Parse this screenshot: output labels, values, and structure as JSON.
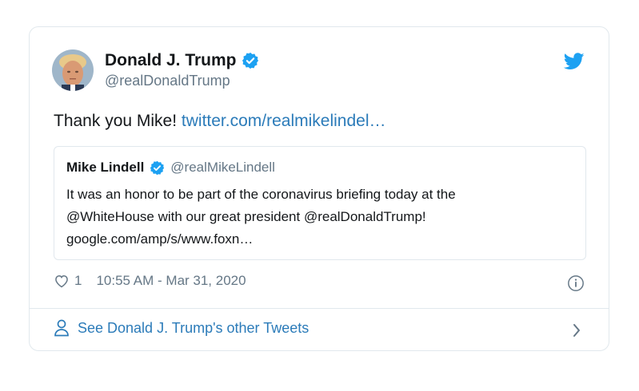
{
  "tweet": {
    "author": {
      "display_name": "Donald J. Trump",
      "handle": "@realDonaldTrump",
      "avatar_icon": "profile-photo"
    },
    "text": "Thank you Mike! ",
    "link_text": "twitter.com/realmikelindel…",
    "quoted": {
      "display_name": "Mike Lindell",
      "handle": "@realMikeLindell",
      "lines": [
        "It was an honor to be part of the coronavirus briefing today at the",
        "@WhiteHouse with our great president @realDonaldTrump!",
        "google.com/amp/s/www.foxn…"
      ]
    },
    "likes": "1",
    "timestamp": "10:55 AM - Mar 31, 2020",
    "footer_link": "See Donald J. Trump's other Tweets"
  },
  "colors": {
    "link": "#2b7bb9",
    "verified": "#1da1f2",
    "muted": "#657786",
    "border": "#e1e8ed"
  },
  "icons": [
    "twitter-bird-icon",
    "verified-badge-icon",
    "heart-icon",
    "info-icon",
    "person-icon",
    "chevron-right-icon"
  ]
}
